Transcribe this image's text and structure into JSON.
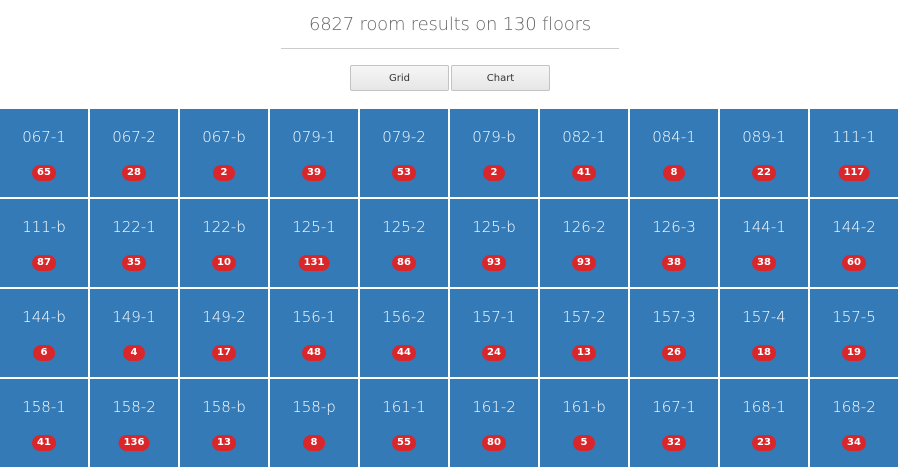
{
  "header": {
    "title": "6827 room results on 130 floors"
  },
  "view_toggle": {
    "grid_label": "Grid",
    "chart_label": "Chart"
  },
  "colors": {
    "tile": "#337ab7",
    "badge": "#d9262a"
  },
  "tiles": [
    {
      "label": "067-1",
      "count": "65"
    },
    {
      "label": "067-2",
      "count": "28"
    },
    {
      "label": "067-b",
      "count": "2"
    },
    {
      "label": "079-1",
      "count": "39"
    },
    {
      "label": "079-2",
      "count": "53"
    },
    {
      "label": "079-b",
      "count": "2"
    },
    {
      "label": "082-1",
      "count": "41"
    },
    {
      "label": "084-1",
      "count": "8"
    },
    {
      "label": "089-1",
      "count": "22"
    },
    {
      "label": "111-1",
      "count": "117"
    },
    {
      "label": "111-b",
      "count": "87"
    },
    {
      "label": "122-1",
      "count": "35"
    },
    {
      "label": "122-b",
      "count": "10"
    },
    {
      "label": "125-1",
      "count": "131"
    },
    {
      "label": "125-2",
      "count": "86"
    },
    {
      "label": "125-b",
      "count": "93"
    },
    {
      "label": "126-2",
      "count": "93"
    },
    {
      "label": "126-3",
      "count": "38"
    },
    {
      "label": "144-1",
      "count": "38"
    },
    {
      "label": "144-2",
      "count": "60"
    },
    {
      "label": "144-b",
      "count": "6"
    },
    {
      "label": "149-1",
      "count": "4"
    },
    {
      "label": "149-2",
      "count": "17"
    },
    {
      "label": "156-1",
      "count": "48"
    },
    {
      "label": "156-2",
      "count": "44"
    },
    {
      "label": "157-1",
      "count": "24"
    },
    {
      "label": "157-2",
      "count": "13"
    },
    {
      "label": "157-3",
      "count": "26"
    },
    {
      "label": "157-4",
      "count": "18"
    },
    {
      "label": "157-5",
      "count": "19"
    },
    {
      "label": "158-1",
      "count": "41"
    },
    {
      "label": "158-2",
      "count": "136"
    },
    {
      "label": "158-b",
      "count": "13"
    },
    {
      "label": "158-p",
      "count": "8"
    },
    {
      "label": "161-1",
      "count": "55"
    },
    {
      "label": "161-2",
      "count": "80"
    },
    {
      "label": "161-b",
      "count": "5"
    },
    {
      "label": "167-1",
      "count": "32"
    },
    {
      "label": "168-1",
      "count": "23"
    },
    {
      "label": "168-2",
      "count": "34"
    }
  ]
}
